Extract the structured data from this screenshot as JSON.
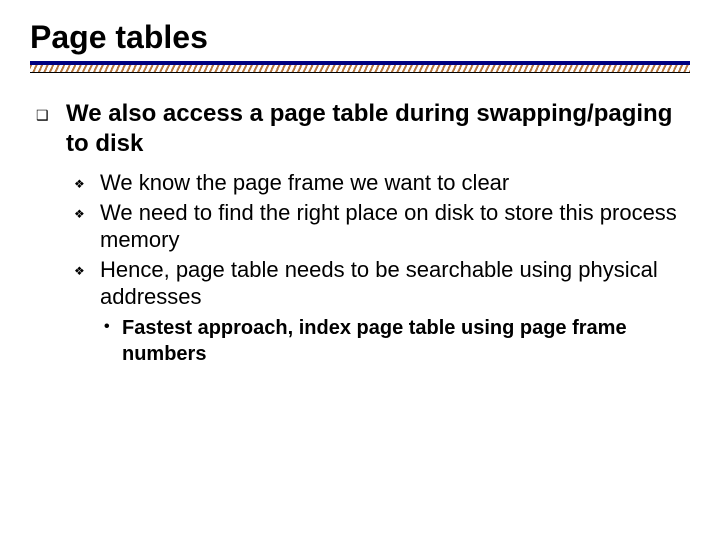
{
  "title": "Page tables",
  "bullet1": "We also access a page table during swapping/paging to disk",
  "sub": {
    "a": "We know the page frame we want to clear",
    "b": "We need to find the right place on disk to store this process memory",
    "c": "Hence, page table needs to be searchable using physical addresses"
  },
  "subsub": "Fastest approach, index page table using page frame numbers"
}
